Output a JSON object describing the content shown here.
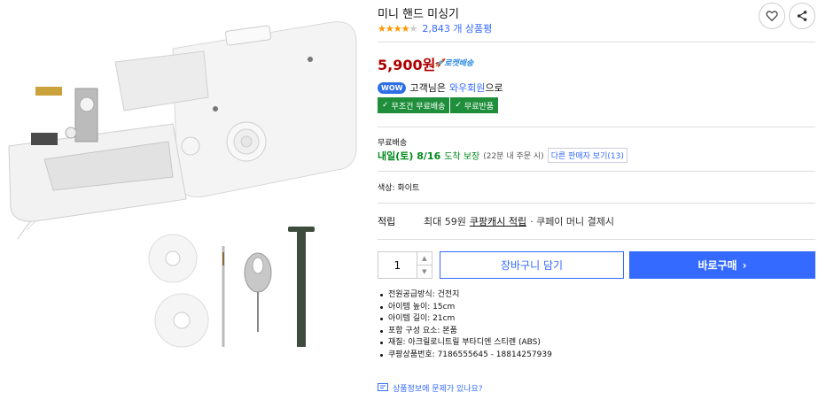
{
  "product": {
    "title": "미니 핸드 미싱기",
    "rating": 4.0,
    "review_count": "2,843 개 상품평",
    "price": "5,900원",
    "rocket_label": "로켓배송"
  },
  "wow": {
    "badge": "WOW",
    "text_prefix": "고객님은 ",
    "member_text": "와우회원",
    "text_suffix": "으로"
  },
  "badges": [
    {
      "label": "무조건 무료배송"
    },
    {
      "label": "무료반품"
    }
  ],
  "shipping": {
    "label": "무료배송",
    "date": "내일(토) 8/16",
    "guarantee": "도착 보장",
    "note": "(22분 내 주문 시)",
    "other_sellers": "다른 판매자 보기(13)"
  },
  "option": {
    "color": "색상: 화이트"
  },
  "points": {
    "label": "적립",
    "text": "최대 59원",
    "link": "쿠팡캐시 적립",
    "extra": "· 쿠페이 머니 결제시"
  },
  "purchase": {
    "quantity": "1",
    "cart_label": "장바구니 담기",
    "buy_label": "바로구매"
  },
  "specs": [
    "전원공급방식: 건전지",
    "아이템 높이: 15cm",
    "아이템 길이: 21cm",
    "포함 구성 요소: 본품",
    "재질: 아크릴로니트릴 부타디엔 스티렌 (ABS)",
    "쿠팡상품번호: 7186555645 - 18814257939"
  ],
  "report": {
    "text": "상품정보에 문제가 있나요?"
  },
  "colors": {
    "accent": "#346aff",
    "price": "#ae0000",
    "green": "#1f8f3b",
    "star": "#ff9600"
  }
}
